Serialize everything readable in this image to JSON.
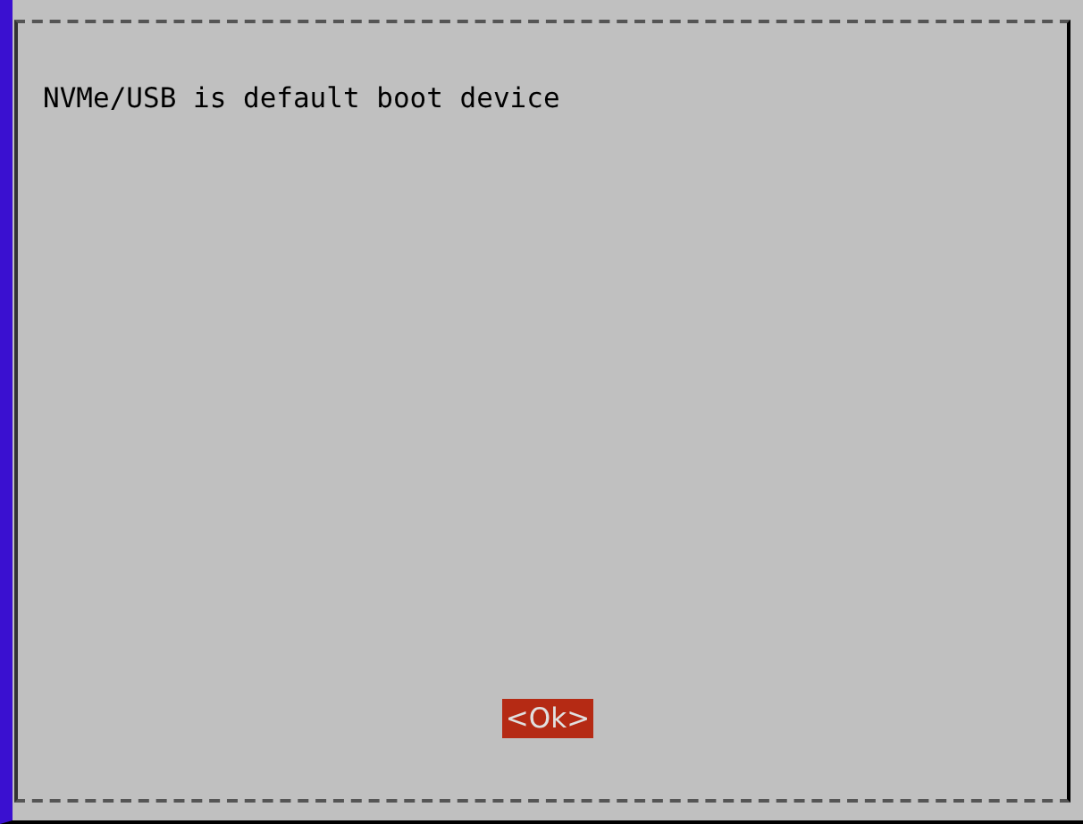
{
  "dialog": {
    "message": "NVMe/USB is default boot device",
    "buttons": [
      {
        "label": "<Ok>",
        "selected": true
      }
    ]
  }
}
